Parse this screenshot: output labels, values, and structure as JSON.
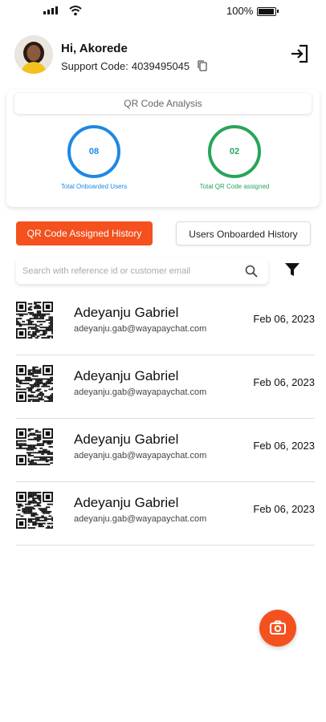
{
  "status_bar": {
    "battery": "100%",
    "battery_level": 1.0
  },
  "header": {
    "greeting": "Hi, Akorede",
    "support_label": "Support Code:",
    "support_code": "4039495045"
  },
  "analysis": {
    "title": "QR Code Analysis",
    "stats": [
      {
        "value": "08",
        "label": "Total Onboarded Users",
        "color": "#1e88e5"
      },
      {
        "value": "02",
        "label": "Total QR Code assigned",
        "color": "#27a55a"
      }
    ]
  },
  "tabs": {
    "active": "QR Code Assigned History",
    "inactive": "Users Onboarded History"
  },
  "search": {
    "placeholder": "Search with reference id or customer email",
    "value": ""
  },
  "list": [
    {
      "name": "Adeyanju Gabriel",
      "email": "adeyanju.gab@wayapaychat.com",
      "date": "Feb 06, 2023"
    },
    {
      "name": "Adeyanju Gabriel",
      "email": "adeyanju.gab@wayapaychat.com",
      "date": "Feb 06, 2023"
    },
    {
      "name": "Adeyanju Gabriel",
      "email": "adeyanju.gab@wayapaychat.com",
      "date": "Feb 06, 2023"
    },
    {
      "name": "Adeyanju Gabriel",
      "email": "adeyanju.gab@wayapaychat.com",
      "date": "Feb 06, 2023"
    }
  ],
  "colors": {
    "accent": "#f4511e",
    "blue": "#1e88e5",
    "green": "#27a55a"
  },
  "icons": [
    "signal-icon",
    "wifi-icon",
    "battery-icon",
    "copy-icon",
    "logout-icon",
    "search-icon",
    "filter-icon",
    "qr-code-icon",
    "camera-icon"
  ]
}
